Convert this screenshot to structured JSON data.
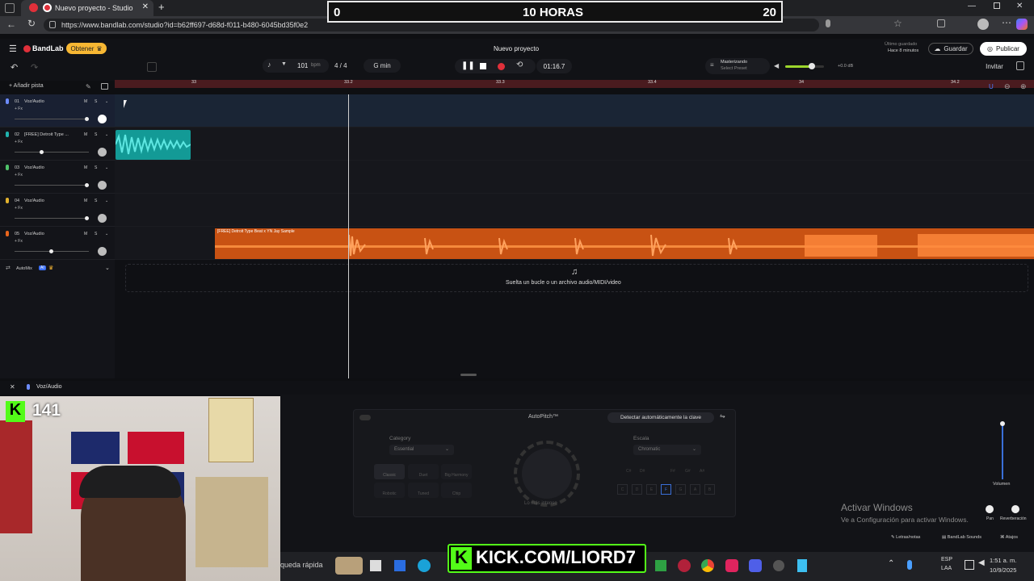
{
  "browser": {
    "tab_title": "Nuevo proyecto - Studio",
    "url": "https://www.bandlab.com/studio?id=b62ff697-d68d-f011-b480-6045bd35f0e2"
  },
  "overlay": {
    "score_left": "0",
    "score_center": "10 HORAS",
    "score_right": "20",
    "kick_count": "141",
    "kick_banner": "KICK.COM/LIORD7"
  },
  "header": {
    "logo": "BandLab",
    "get_button": "Obtener",
    "project_title": "Nuevo proyecto",
    "last_saved_label": "Último guardado",
    "last_saved_value": "Hace 8 minutos",
    "save_button": "Guardar",
    "publish_button": "Publicar",
    "invite_button": "Invitar"
  },
  "transport": {
    "bpm_value": "101",
    "bpm_unit": "bpm",
    "time_signature": "4 / 4",
    "key": "G min",
    "time": "01:16.7",
    "mastering_label": "Masterizando",
    "mastering_preset": "Select Preset",
    "volume_db": "+0.0 dB"
  },
  "tracks_panel": {
    "add_track": "Añadir pista",
    "automix_label": "AutoMix",
    "automix_badge": "AI"
  },
  "ruler": {
    "ticks": [
      "33",
      "33.2",
      "33.3",
      "33.4",
      "34",
      "34.2"
    ]
  },
  "tracks": [
    {
      "number": "01",
      "name": "Voz/Audio",
      "fx": "+ Fx",
      "mute": "M",
      "solo": "S",
      "volume": 0.95
    },
    {
      "number": "02",
      "name": "[FREE] Detroit Type ...",
      "fx": "+ Fx",
      "mute": "M",
      "solo": "S",
      "volume": 0.38
    },
    {
      "number": "03",
      "name": "Voz/Audio",
      "fx": "+ Fx",
      "mute": "M",
      "solo": "S",
      "volume": 0.95
    },
    {
      "number": "04",
      "name": "Voz/Audio",
      "fx": "+ Fx",
      "mute": "M",
      "solo": "S",
      "volume": 0.95
    },
    {
      "number": "05",
      "name": "Voz/Audio",
      "fx": "+ Fx",
      "mute": "M",
      "solo": "S",
      "volume": 0.5
    }
  ],
  "clips": {
    "track5_clip_name": "[FREE] Detroit Type Beat x YN Jay Sample"
  },
  "drop_zone": {
    "text": "Suelta un bucle o un archivo audio/MIDI/video"
  },
  "bottom_panel": {
    "track_name": "Voz/Audio",
    "autopitch_title": "AutoPitch™",
    "detect_key_button": "Detectar automáticamente la clave",
    "category_label": "Category",
    "category_value": "Essential",
    "presets": [
      "Classic",
      "Duet",
      "Big Harmony",
      "Robotic",
      "Tuned",
      "Chip"
    ],
    "scale_label": "Escala",
    "scale_value": "Chromatic",
    "notes_top": [
      "C#",
      "D#",
      "F#",
      "G#",
      "A#"
    ],
    "notes_bottom": [
      "C",
      "D",
      "E",
      "F",
      "G",
      "A",
      "B"
    ],
    "knob_label": "Lo más intenso",
    "volume_label": "Volumen",
    "pan_label": "Pan",
    "reverb_label": "Reverberación",
    "lyrics_button": "Letras/notas",
    "sounds_button": "BandLab Sounds",
    "shortcuts_button": "Atajos"
  },
  "windows": {
    "activate_title": "Activar Windows",
    "activate_sub": "Ve a Configuración para activar Windows.",
    "search_text": "queda rápida",
    "lang_top": "ESP",
    "lang_bottom": "LAA",
    "clock_time": "1:51 a. m.",
    "clock_date": "10/9/2025"
  },
  "colors": {
    "accent_red": "#e0303a",
    "clip_teal": "#20b3ae",
    "clip_orange": "#e8651c",
    "get_button_bg": "#f7b733",
    "kick_green": "#53fc18"
  }
}
